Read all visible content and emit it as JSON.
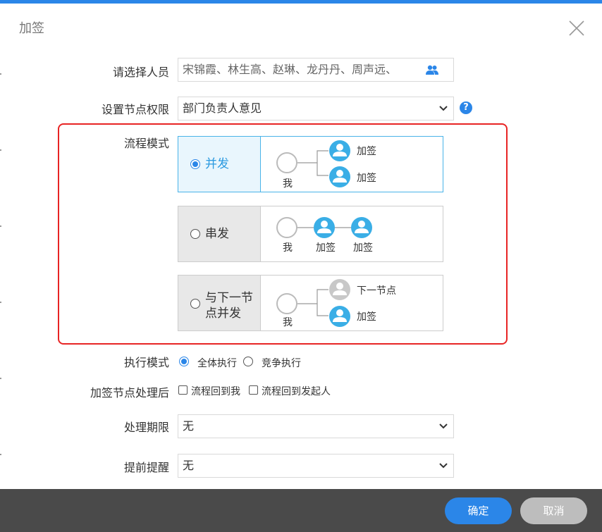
{
  "dialog": {
    "title": "加签"
  },
  "form": {
    "select_people": {
      "label": "请选择人员",
      "value": "宋锦霞、林生高、赵琳、龙丹丹、周声远、"
    },
    "node_permission": {
      "label": "设置节点权限",
      "value": "部门负责人意见",
      "help": "?"
    },
    "flow_mode": {
      "label": "流程模式",
      "options": [
        {
          "label": "并发",
          "selected": true,
          "diagram": {
            "me": "我",
            "targets": [
              "加签",
              "加签"
            ]
          }
        },
        {
          "label": "串发",
          "selected": false,
          "diagram": {
            "me": "我",
            "targets": [
              "加签",
              "加签"
            ]
          }
        },
        {
          "label_lines": [
            "与下一节",
            "点并发"
          ],
          "selected": false,
          "diagram": {
            "me": "我",
            "targets": [
              "下一节点",
              "加签"
            ]
          }
        }
      ]
    },
    "exec_mode": {
      "label": "执行模式",
      "options": [
        {
          "label": "全体执行",
          "selected": true
        },
        {
          "label": "竞争执行",
          "selected": false
        }
      ]
    },
    "after_sign": {
      "label": "加签节点处理后",
      "options": [
        {
          "label": "流程回到我",
          "checked": false
        },
        {
          "label": "流程回到发起人",
          "checked": false
        }
      ]
    },
    "deadline": {
      "label": "处理期限",
      "value": "无"
    },
    "reminder": {
      "label": "提前提醒",
      "value": "无"
    }
  },
  "buttons": {
    "ok": "确定",
    "cancel": "取消"
  },
  "colors": {
    "primary": "#2b86e8",
    "node_blue": "#3aaee6",
    "node_gray": "#c8c8c8",
    "highlight_border": "#e82424"
  }
}
